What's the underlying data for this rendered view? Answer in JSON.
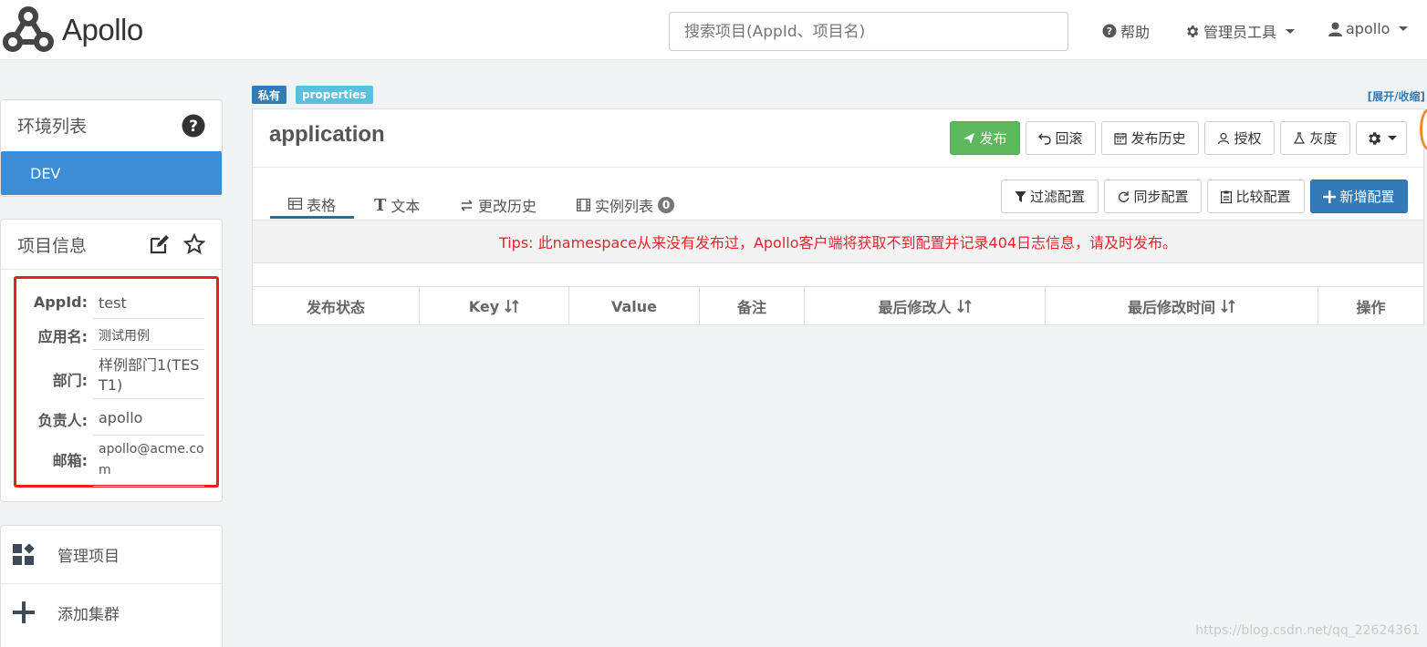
{
  "app": {
    "name": "Apollo"
  },
  "header": {
    "search_placeholder": "搜索项目(AppId、项目名)",
    "help_label": "帮助",
    "admin_tools_label": "管理员工具",
    "user_label": "apollo"
  },
  "env_panel": {
    "title": "环境列表",
    "items": [
      {
        "label": "DEV"
      }
    ]
  },
  "project_panel": {
    "title": "项目信息",
    "fields": [
      {
        "label": "AppId:",
        "value": "test"
      },
      {
        "label": "应用名:",
        "value": "测试用例"
      },
      {
        "label": "部门:",
        "value": "样例部门1(TEST1)"
      },
      {
        "label": "负责人:",
        "value": "apollo"
      },
      {
        "label": "邮箱:",
        "value": "apollo@acme.com"
      }
    ]
  },
  "side_menu": [
    {
      "label": "管理项目"
    },
    {
      "label": "添加集群"
    }
  ],
  "namespace": {
    "tags": [
      "私有",
      "properties"
    ],
    "expand_label": "[展开/收缩]",
    "name": "application",
    "actions": {
      "publish": "发布",
      "rollback": "回滚",
      "history": "发布历史",
      "authorize": "授权",
      "gray": "灰度"
    },
    "tabs": [
      {
        "label": "表格"
      },
      {
        "label": "文本"
      },
      {
        "label": "更改历史"
      },
      {
        "label": "实例列表",
        "badge": "0"
      }
    ],
    "tools": {
      "filter": "过滤配置",
      "sync": "同步配置",
      "compare": "比较配置",
      "add": "新增配置"
    },
    "tips": "Tips: 此namespace从来没有发布过，Apollo客户端将获取不到配置并记录404日志信息，请及时发布。",
    "table_headers": [
      "发布状态",
      "Key",
      "Value",
      "备注",
      "最后修改人",
      "最后修改时间",
      "操作"
    ]
  },
  "watermark": "https://blog.csdn.net/qq_22624361",
  "colors": {
    "primary": "#337ab7",
    "success": "#5cb85c",
    "env_active": "#3c8dd5",
    "tips_text": "#e4252c",
    "highlight_border": "#ee1c24"
  }
}
